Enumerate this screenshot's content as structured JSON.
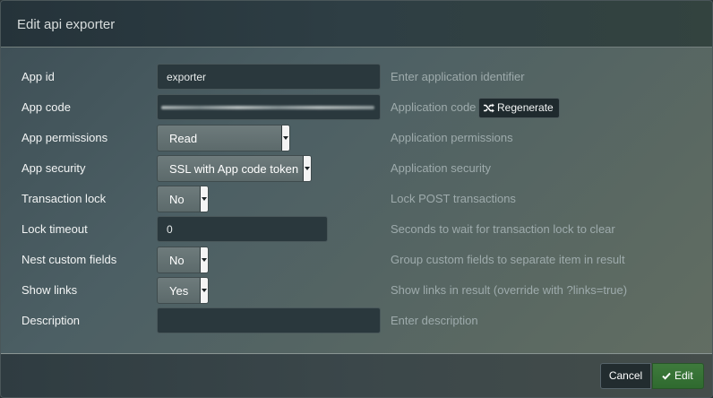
{
  "dialog": {
    "title": "Edit api exporter"
  },
  "form": {
    "app_id": {
      "label": "App id",
      "value": "exporter",
      "help": "Enter application identifier"
    },
    "app_code": {
      "label": "App code",
      "help": "Application code",
      "regenerate_label": "Regenerate",
      "regenerate_icon": "shuffle-icon"
    },
    "app_permissions": {
      "label": "App permissions",
      "value": "Read",
      "help": "Application permissions"
    },
    "app_security": {
      "label": "App security",
      "value": "SSL with App code token",
      "help": "Application security"
    },
    "transaction_lock": {
      "label": "Transaction lock",
      "value": "No",
      "help": "Lock POST transactions"
    },
    "lock_timeout": {
      "label": "Lock timeout",
      "value": "0",
      "help": "Seconds to wait for transaction lock to clear"
    },
    "nest_custom_fields": {
      "label": "Nest custom fields",
      "value": "No",
      "help": "Group custom fields to separate item in result"
    },
    "show_links": {
      "label": "Show links",
      "value": "Yes",
      "help": "Show links in result (override with ?links=true)"
    },
    "description": {
      "label": "Description",
      "value": "",
      "help": "Enter description"
    }
  },
  "footer": {
    "cancel_label": "Cancel",
    "edit_label": "Edit",
    "edit_icon": "check-icon"
  },
  "colors": {
    "edit_button": "#2f6a2f",
    "header": "#2e3e44",
    "input_bg": "#2a383d"
  }
}
